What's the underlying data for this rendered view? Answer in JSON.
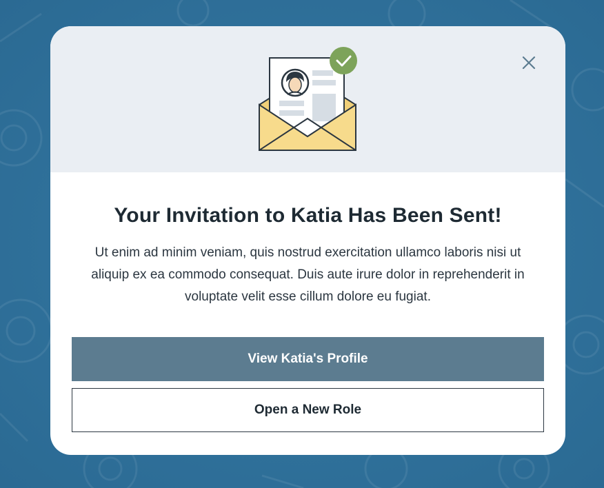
{
  "modal": {
    "title": "Your Invitation to Katia Has Been Sent!",
    "body": "Ut enim ad minim veniam, quis nostrud exercitation ullamco laboris nisi ut aliquip ex ea commodo consequat. Duis aute irure dolor in reprehenderit in voluptate velit esse cillum dolore eu fugiat.",
    "close_icon": "close-icon",
    "illustration_icon": "envelope-with-profile-card-icon",
    "primary_button_label": "View Katia's Profile",
    "secondary_button_label": "Open a New Role"
  },
  "colors": {
    "background": "#2f6f99",
    "header_background": "#eaeef3",
    "primary_button": "#5c7c90",
    "check_badge": "#7da35a",
    "envelope": "#f7db8c"
  }
}
